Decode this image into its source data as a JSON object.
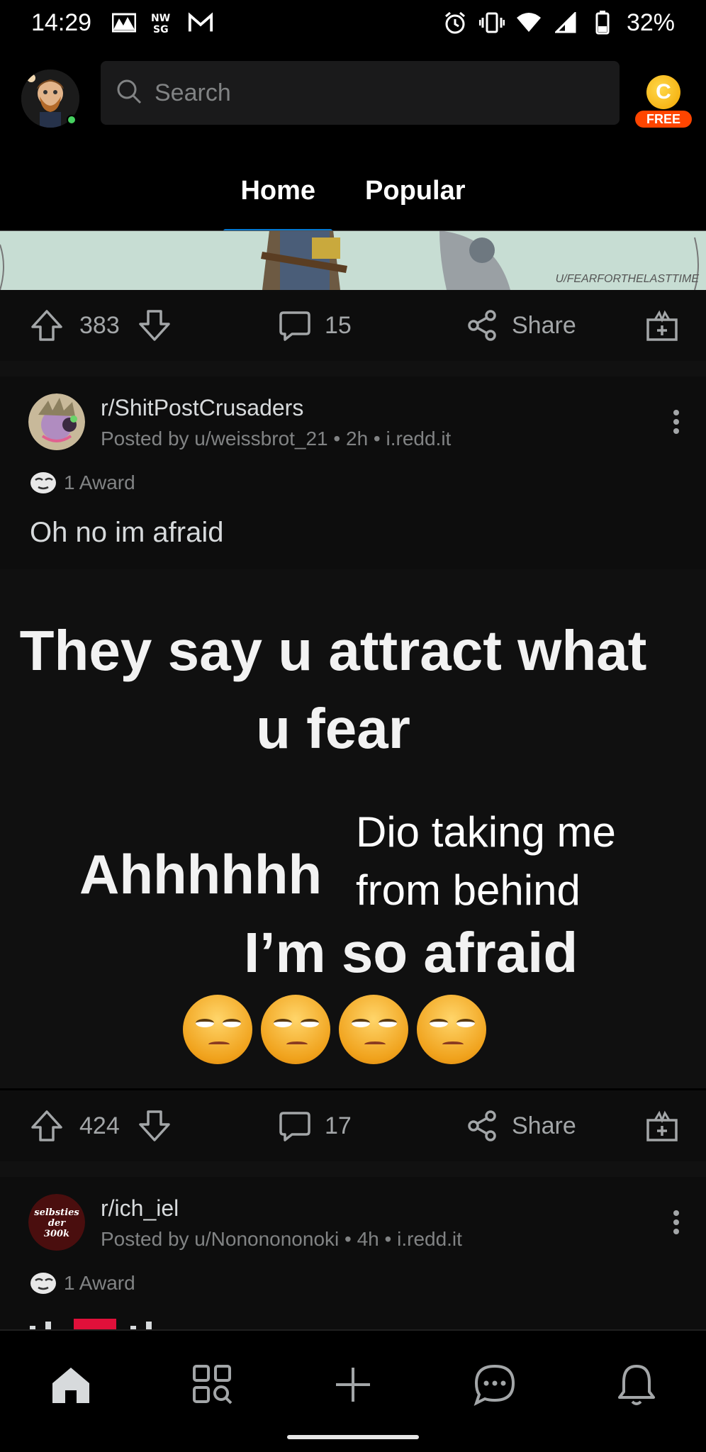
{
  "status_bar": {
    "time": "14:29",
    "icons_left": [
      "photo-icon",
      "nw-sg-icon",
      "gmail-icon"
    ],
    "icons_right": [
      "alarm-icon",
      "vibrate-icon",
      "wifi-icon",
      "signal-icon",
      "battery-icon"
    ],
    "battery": "32%"
  },
  "top_bar": {
    "search_placeholder": "Search",
    "coin_letter": "C",
    "free_badge": "FREE"
  },
  "tabs": [
    {
      "label": "Home",
      "active": true
    },
    {
      "label": "Popular",
      "active": false
    }
  ],
  "prev_post": {
    "image_credit": "U/FEARFORTHELASTTIME",
    "votes": "383",
    "comments": "15",
    "share": "Share"
  },
  "post1": {
    "subreddit": "r/ShitPostCrusaders",
    "meta": "Posted by u/weissbrot_21 • 2h • i.redd.it",
    "award": "1 Award",
    "title": "Oh no im afraid",
    "meme": {
      "line1": "They say u attract what u fear",
      "line2": "Ahhhhhh",
      "line3": "Dio taking me from behind",
      "line4": "I’m so afraid"
    },
    "votes": "424",
    "comments": "17",
    "share": "Share"
  },
  "post2": {
    "subreddit": "r/ich_iel",
    "avatar_text": "selbsties der 300k",
    "meta": "Posted by u/Nononononoki • 4h • i.redd.it",
    "award": "1 Award"
  },
  "bottom_nav": [
    "home-icon",
    "discover-icon",
    "create-icon",
    "chat-icon",
    "notifications-icon"
  ],
  "colors": {
    "accent": "#0079d3",
    "orange": "#ff4500",
    "online": "#46d160"
  }
}
